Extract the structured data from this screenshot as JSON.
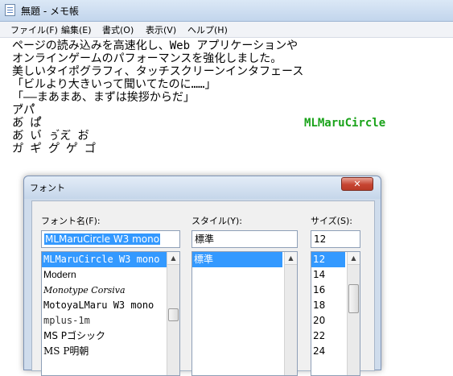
{
  "window": {
    "title": "無題 - メモ帳"
  },
  "menu": [
    "ファイル(F)",
    "編集(E)",
    "書式(O)",
    "表示(V)",
    "ヘルプ(H)"
  ],
  "editor": {
    "lines": [
      "ページの読み込みを高速化し、Web アプリケーションや",
      "オンラインゲームのパフォーマンスを強化しました。",
      "美しいタイポグラフィ、タッチスクリーンインタフェース",
      "「ビルより大きいって聞いてたのに……」",
      "「——まあまあ、まずは挨拶からだ」",
      "ア゙パ゚",
      "あ゙ ぱ゚",
      "あ゙ い゙ ぅ゙え゙ お゙",
      "カ゚ キ゚ ク゚ ケ゚ コ゚"
    ],
    "font_sample": "MLMaruCircle",
    "font_sample_color": "#1aa31a"
  },
  "dialog": {
    "title": "フォント",
    "close_icon": "close-icon",
    "font_name_label": "フォント名(F):",
    "font_name_value": "MLMaruCircle W3 mono",
    "font_list": [
      "MLMaruCircle W3 mono",
      "Modern",
      "Monotype Corsiva",
      "MotoyaLMaru W3 mono",
      "mplus-1m",
      "MS Pゴシック",
      "MS P明朝"
    ],
    "style_label": "スタイル(Y):",
    "style_value": "標準",
    "style_list": [
      "標準"
    ],
    "size_label": "サイズ(S):",
    "size_value": "12",
    "size_list": [
      "12",
      "14",
      "16",
      "18",
      "20",
      "22",
      "24"
    ]
  }
}
